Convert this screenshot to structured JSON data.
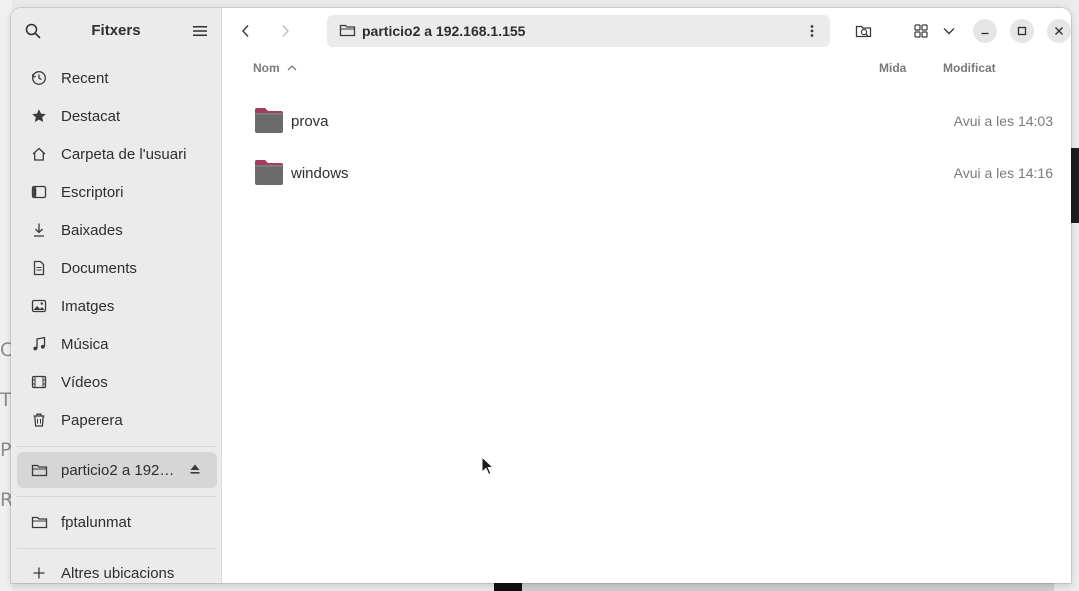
{
  "sidebar": {
    "title": "Fitxers",
    "places": [
      {
        "label": "Recent",
        "icon": "clock-icon"
      },
      {
        "label": "Destacat",
        "icon": "star-icon"
      },
      {
        "label": "Carpeta de l'usuari",
        "icon": "home-icon"
      },
      {
        "label": "Escriptori",
        "icon": "desktop-icon"
      },
      {
        "label": "Baixades",
        "icon": "download-icon"
      },
      {
        "label": "Documents",
        "icon": "document-icon"
      },
      {
        "label": "Imatges",
        "icon": "image-icon"
      },
      {
        "label": "Música",
        "icon": "music-icon"
      },
      {
        "label": "Vídeos",
        "icon": "video-icon"
      },
      {
        "label": "Paperera",
        "icon": "trash-icon"
      }
    ],
    "mounts": [
      {
        "label": "particio2 a 192…",
        "icon": "network-folder-icon",
        "selected": true
      }
    ],
    "bookmarks": [
      {
        "label": "fptalunmat",
        "icon": "folder-icon"
      }
    ],
    "other_locations": "Altres ubicacions"
  },
  "toolbar": {
    "path": "particio2 a 192.168.1.155"
  },
  "columns": {
    "name": "Nom",
    "size": "Mida",
    "modified": "Modificat"
  },
  "files": [
    {
      "name": "prova",
      "size": "",
      "modified": "Avui a les 14:03"
    },
    {
      "name": "windows",
      "size": "",
      "modified": "Avui a les 14:16"
    }
  ],
  "colors": {
    "folder_body": "#6b6b6b",
    "folder_tab": "#a53b5f",
    "accent": "#e95420"
  }
}
